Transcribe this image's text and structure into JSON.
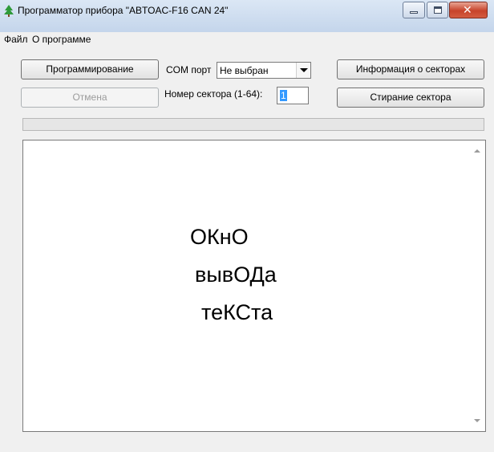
{
  "window": {
    "title": "Программатор прибора \"ABTOAC-F16 CAN 24\"",
    "icon": "tree-app-icon"
  },
  "menu": {
    "file": "Файл",
    "about": "О программе"
  },
  "toolbar": {
    "program_label": "Программирование",
    "cancel_label": "Отмена",
    "info_label": "Информация о секторах",
    "erase_label": "Стирание сектора",
    "com_port_label": "COM порт",
    "com_port_value": "Не выбран",
    "sector_label": "Номер сектора (1-64):",
    "sector_value": "1"
  },
  "output": {
    "lines": [
      "ОКнО",
      "вывОДа",
      "теКСта"
    ]
  },
  "colors": {
    "close_button": "#c7432b",
    "selection": "#3399ff",
    "titlebar": "#dbe7f5"
  }
}
